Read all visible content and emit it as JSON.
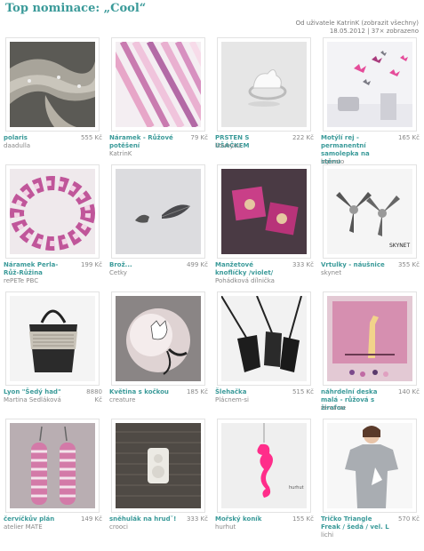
{
  "header": {
    "title": "Top nominace: „Cool“",
    "author_prefix": "Od uživatele KatrinK",
    "show_all_link": "(zobrazit všechny)",
    "date_views": "18.05.2012 | 37× zobrazeno"
  },
  "items": [
    {
      "name": "polaris",
      "price": "555 Kč",
      "seller": "daadulla",
      "icon": "knitted-scarf-photo"
    },
    {
      "name": "Náramek - Růžové potěšení",
      "price": "79 Kč",
      "seller": "KatrinK",
      "icon": "beaded-bracelets-photo"
    },
    {
      "name": "PRSTEN S UŠÁČKEM",
      "price": "222 Kč",
      "seller": "iloveyou",
      "icon": "bunny-ring-photo"
    },
    {
      "name": "Motýlí rej - permanentní samolepka na stěnu",
      "price": "165 Kč",
      "seller": "lepeato",
      "icon": "butterfly-wall-sticker-photo"
    },
    {
      "name": "Náramek Perla-Růž-Růžina",
      "price": "199 Kč",
      "seller": "rePETe PBC",
      "icon": "woven-bracelet-photo"
    },
    {
      "name": "Brož...",
      "price": "499 Kč",
      "seller": "Cetky",
      "icon": "bird-feather-brooch-photo"
    },
    {
      "name": "Manžetové knoflíčky /violet/",
      "price": "333 Kč",
      "seller": "Pohádková dílnička",
      "icon": "cufflinks-photo"
    },
    {
      "name": "Vrtulky - náušnice",
      "price": "355 Kč",
      "seller": "skynet",
      "icon": "propeller-earrings-photo"
    },
    {
      "name": "Lyon \"Šedý had\"",
      "price": "8880 Kč",
      "seller": "Martina Sedláková",
      "icon": "handbag-photo"
    },
    {
      "name": "Květina s kočkou",
      "price": "185 Kč",
      "seller": "creature",
      "icon": "cat-flower-photo"
    },
    {
      "name": "Šlehačka",
      "price": "515 Kč",
      "seller": "Plácnem-si",
      "icon": "leather-tags-photo"
    },
    {
      "name": "náhrdelní deska malá - růžová s žirafou",
      "price": "140 Kč",
      "seller": "re-ca-se",
      "icon": "giraffe-board-photo"
    },
    {
      "name": "červíčkův plán",
      "price": "149 Kč",
      "seller": "atelier MATE",
      "icon": "striped-earrings-photo"
    },
    {
      "name": "sněhulák na hrudˇ!",
      "price": "333 Kč",
      "seller": "crooci",
      "icon": "snowman-pendant-photo"
    },
    {
      "name": "Mořský koník",
      "price": "155 Kč",
      "seller": "hurhut",
      "icon": "seahorse-pendant-photo"
    },
    {
      "name": "Tričko Triangle Freak / šedá / vel. L",
      "price": "570 Kč",
      "seller": "lichi",
      "icon": "tshirt-photo"
    }
  ]
}
